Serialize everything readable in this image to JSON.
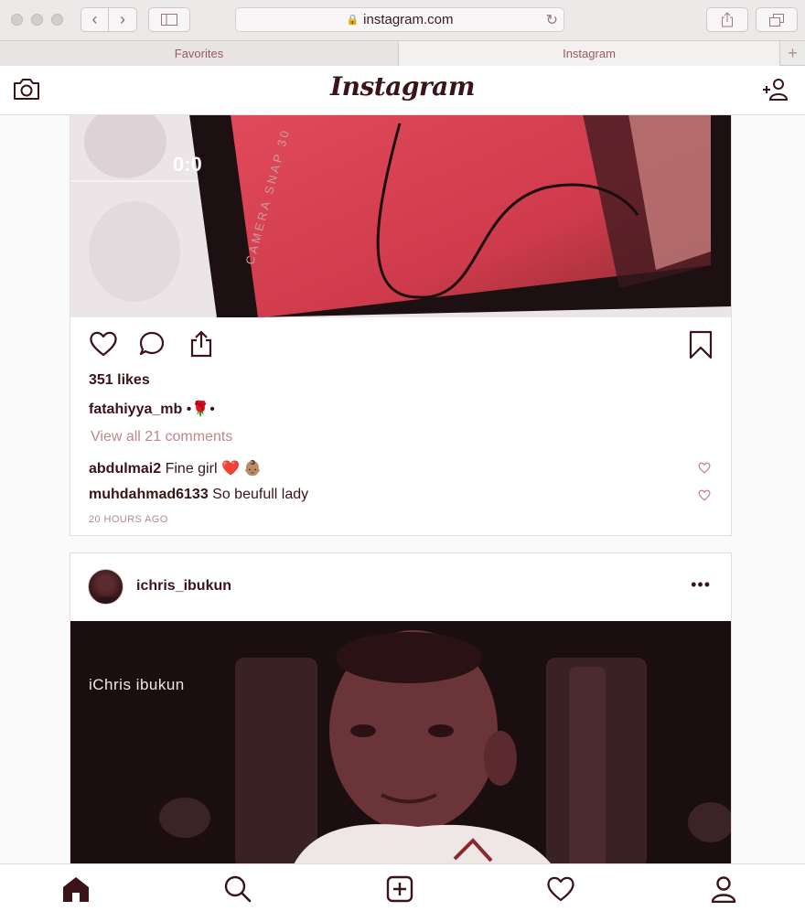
{
  "browser": {
    "url": "instagram.com",
    "tabs": [
      "Favorites",
      "Instagram"
    ],
    "new_tab_symbol": "+"
  },
  "app": {
    "logo": "Instagram"
  },
  "post1": {
    "likes": "351 likes",
    "caption_user": "fatahiyya_mb",
    "caption_text": " •🌹•",
    "view_comments": "View all 21 comments",
    "comments": [
      {
        "user": "abdulmai2",
        "text": " Fine girl ❤️ 👶🏽"
      },
      {
        "user": "muhdahmad6133",
        "text": " So beufull lady"
      }
    ],
    "timestamp": "20 HOURS AGO",
    "photo_overlay_text": "CAMERA SNAP 30",
    "timer_text": "0:0"
  },
  "post2": {
    "username": "ichris_ibukun",
    "more": "•••",
    "photo_watermark": "iChris ibukun"
  },
  "icons": {
    "camera": "camera-icon",
    "add_user": "add-user-icon",
    "like": "heart-icon",
    "comment": "comment-icon",
    "share": "share-icon",
    "save": "bookmark-icon",
    "home": "home-icon",
    "search": "search-icon",
    "new_post": "plus-square-icon",
    "activity": "heart-icon",
    "profile": "person-icon"
  },
  "colors": {
    "tint": "#3a1418",
    "muted": "#c0868c",
    "accent_red": "#d24454"
  }
}
